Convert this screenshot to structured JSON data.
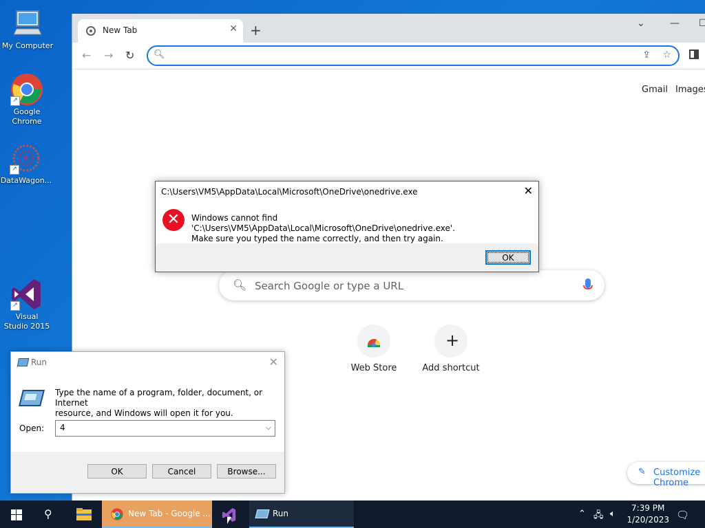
{
  "desktop": {
    "icons": [
      {
        "label": "My Computer"
      },
      {
        "label": "Google Chrome"
      },
      {
        "label": "DataWagon..."
      },
      {
        "label": "Visual Studio 2015"
      }
    ]
  },
  "chrome": {
    "tab_title": "New Tab",
    "omnibox_value": "",
    "links": {
      "gmail": "Gmail",
      "images": "Images"
    },
    "search_placeholder": "Search Google or type a URL",
    "shortcuts": [
      {
        "label": "Web Store"
      },
      {
        "label": "Add shortcut"
      }
    ],
    "customize_label": "Customize Chrome"
  },
  "error_dialog": {
    "title": "C:\\Users\\VM5\\AppData\\Local\\Microsoft\\OneDrive\\onedrive.exe",
    "message_line1": "Windows cannot find 'C:\\Users\\VM5\\AppData\\Local\\Microsoft\\OneDrive\\onedrive.exe'.",
    "message_line2": "Make sure you typed the name correctly, and then try again.",
    "ok_label": "OK"
  },
  "run_dialog": {
    "title": "Run",
    "message_line1": "Type the name of a program, folder, document, or Internet",
    "message_line2": "resource, and Windows will open it for you.",
    "open_label": "Open:",
    "open_value": "4",
    "ok_label": "OK",
    "cancel_label": "Cancel",
    "browse_label": "Browse..."
  },
  "taskbar": {
    "chrome_label": "New Tab - Google ...",
    "run_label": "Run",
    "time": "7:39 PM",
    "date": "1/20/2023"
  },
  "colors": {
    "desktop": "#0b63c9",
    "taskbar": "#0f1b2c",
    "accent": "#1a73e8",
    "error": "#e81123"
  }
}
